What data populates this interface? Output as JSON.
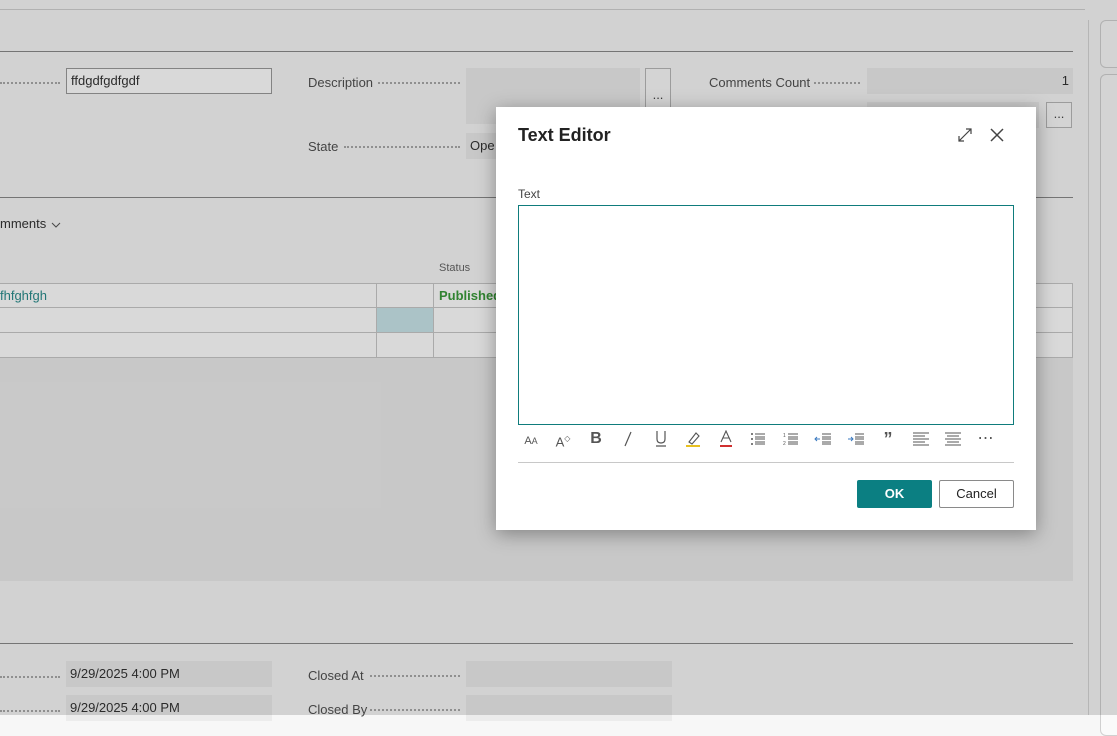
{
  "form": {
    "top_field_value": "ffdgdfgdfgdf",
    "description_label": "Description",
    "state_label": "State",
    "state_value": "Ope",
    "comments_count_label": "Comments Count",
    "comments_count_value": "1",
    "ellipsis": "..."
  },
  "comments_section": {
    "title_partial": "mments",
    "status_header": "Status",
    "rows": [
      {
        "text": "fhfghfgh",
        "status": "Published"
      },
      {
        "text": "",
        "status": ""
      },
      {
        "text": "",
        "status": ""
      }
    ]
  },
  "bottom_section": {
    "created_at": "9/29/2025 4:00 PM",
    "modified_at": "9/29/2025 4:00 PM",
    "closed_at_label": "Closed At",
    "closed_by_label": "Closed By"
  },
  "dialog": {
    "title": "Text Editor",
    "text_label": "Text",
    "ok_label": "OK",
    "cancel_label": "Cancel",
    "toolbar": [
      "font-size-icon",
      "font-style-icon",
      "bold-icon",
      "italic-icon",
      "underline-icon",
      "highlight-icon",
      "font-color-icon",
      "bullet-list-icon",
      "numbered-list-icon",
      "outdent-icon",
      "indent-icon",
      "quote-icon",
      "align-left-icon",
      "align-center-icon",
      "more-icon"
    ]
  },
  "colors": {
    "accent": "#0b7f82",
    "published": "#3a9a3a",
    "link": "#2a8c8c"
  }
}
